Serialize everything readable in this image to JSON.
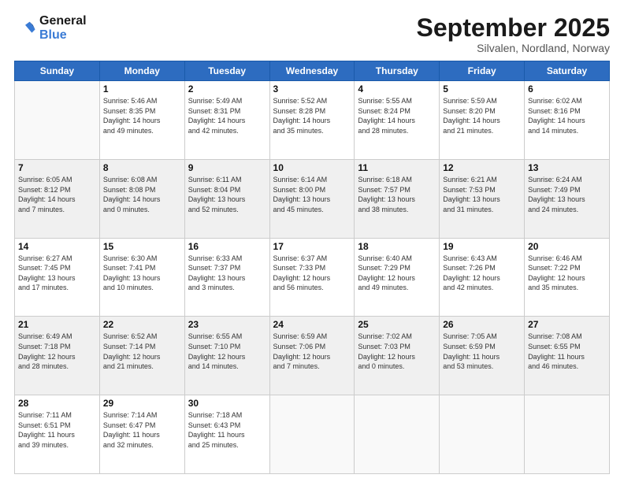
{
  "header": {
    "logo_line1": "General",
    "logo_line2": "Blue",
    "month": "September 2025",
    "location": "Silvalen, Nordland, Norway"
  },
  "days_of_week": [
    "Sunday",
    "Monday",
    "Tuesday",
    "Wednesday",
    "Thursday",
    "Friday",
    "Saturday"
  ],
  "weeks": [
    [
      {
        "day": "",
        "info": ""
      },
      {
        "day": "1",
        "info": "Sunrise: 5:46 AM\nSunset: 8:35 PM\nDaylight: 14 hours\nand 49 minutes."
      },
      {
        "day": "2",
        "info": "Sunrise: 5:49 AM\nSunset: 8:31 PM\nDaylight: 14 hours\nand 42 minutes."
      },
      {
        "day": "3",
        "info": "Sunrise: 5:52 AM\nSunset: 8:28 PM\nDaylight: 14 hours\nand 35 minutes."
      },
      {
        "day": "4",
        "info": "Sunrise: 5:55 AM\nSunset: 8:24 PM\nDaylight: 14 hours\nand 28 minutes."
      },
      {
        "day": "5",
        "info": "Sunrise: 5:59 AM\nSunset: 8:20 PM\nDaylight: 14 hours\nand 21 minutes."
      },
      {
        "day": "6",
        "info": "Sunrise: 6:02 AM\nSunset: 8:16 PM\nDaylight: 14 hours\nand 14 minutes."
      }
    ],
    [
      {
        "day": "7",
        "info": "Sunrise: 6:05 AM\nSunset: 8:12 PM\nDaylight: 14 hours\nand 7 minutes."
      },
      {
        "day": "8",
        "info": "Sunrise: 6:08 AM\nSunset: 8:08 PM\nDaylight: 14 hours\nand 0 minutes."
      },
      {
        "day": "9",
        "info": "Sunrise: 6:11 AM\nSunset: 8:04 PM\nDaylight: 13 hours\nand 52 minutes."
      },
      {
        "day": "10",
        "info": "Sunrise: 6:14 AM\nSunset: 8:00 PM\nDaylight: 13 hours\nand 45 minutes."
      },
      {
        "day": "11",
        "info": "Sunrise: 6:18 AM\nSunset: 7:57 PM\nDaylight: 13 hours\nand 38 minutes."
      },
      {
        "day": "12",
        "info": "Sunrise: 6:21 AM\nSunset: 7:53 PM\nDaylight: 13 hours\nand 31 minutes."
      },
      {
        "day": "13",
        "info": "Sunrise: 6:24 AM\nSunset: 7:49 PM\nDaylight: 13 hours\nand 24 minutes."
      }
    ],
    [
      {
        "day": "14",
        "info": "Sunrise: 6:27 AM\nSunset: 7:45 PM\nDaylight: 13 hours\nand 17 minutes."
      },
      {
        "day": "15",
        "info": "Sunrise: 6:30 AM\nSunset: 7:41 PM\nDaylight: 13 hours\nand 10 minutes."
      },
      {
        "day": "16",
        "info": "Sunrise: 6:33 AM\nSunset: 7:37 PM\nDaylight: 13 hours\nand 3 minutes."
      },
      {
        "day": "17",
        "info": "Sunrise: 6:37 AM\nSunset: 7:33 PM\nDaylight: 12 hours\nand 56 minutes."
      },
      {
        "day": "18",
        "info": "Sunrise: 6:40 AM\nSunset: 7:29 PM\nDaylight: 12 hours\nand 49 minutes."
      },
      {
        "day": "19",
        "info": "Sunrise: 6:43 AM\nSunset: 7:26 PM\nDaylight: 12 hours\nand 42 minutes."
      },
      {
        "day": "20",
        "info": "Sunrise: 6:46 AM\nSunset: 7:22 PM\nDaylight: 12 hours\nand 35 minutes."
      }
    ],
    [
      {
        "day": "21",
        "info": "Sunrise: 6:49 AM\nSunset: 7:18 PM\nDaylight: 12 hours\nand 28 minutes."
      },
      {
        "day": "22",
        "info": "Sunrise: 6:52 AM\nSunset: 7:14 PM\nDaylight: 12 hours\nand 21 minutes."
      },
      {
        "day": "23",
        "info": "Sunrise: 6:55 AM\nSunset: 7:10 PM\nDaylight: 12 hours\nand 14 minutes."
      },
      {
        "day": "24",
        "info": "Sunrise: 6:59 AM\nSunset: 7:06 PM\nDaylight: 12 hours\nand 7 minutes."
      },
      {
        "day": "25",
        "info": "Sunrise: 7:02 AM\nSunset: 7:03 PM\nDaylight: 12 hours\nand 0 minutes."
      },
      {
        "day": "26",
        "info": "Sunrise: 7:05 AM\nSunset: 6:59 PM\nDaylight: 11 hours\nand 53 minutes."
      },
      {
        "day": "27",
        "info": "Sunrise: 7:08 AM\nSunset: 6:55 PM\nDaylight: 11 hours\nand 46 minutes."
      }
    ],
    [
      {
        "day": "28",
        "info": "Sunrise: 7:11 AM\nSunset: 6:51 PM\nDaylight: 11 hours\nand 39 minutes."
      },
      {
        "day": "29",
        "info": "Sunrise: 7:14 AM\nSunset: 6:47 PM\nDaylight: 11 hours\nand 32 minutes."
      },
      {
        "day": "30",
        "info": "Sunrise: 7:18 AM\nSunset: 6:43 PM\nDaylight: 11 hours\nand 25 minutes."
      },
      {
        "day": "",
        "info": ""
      },
      {
        "day": "",
        "info": ""
      },
      {
        "day": "",
        "info": ""
      },
      {
        "day": "",
        "info": ""
      }
    ]
  ]
}
